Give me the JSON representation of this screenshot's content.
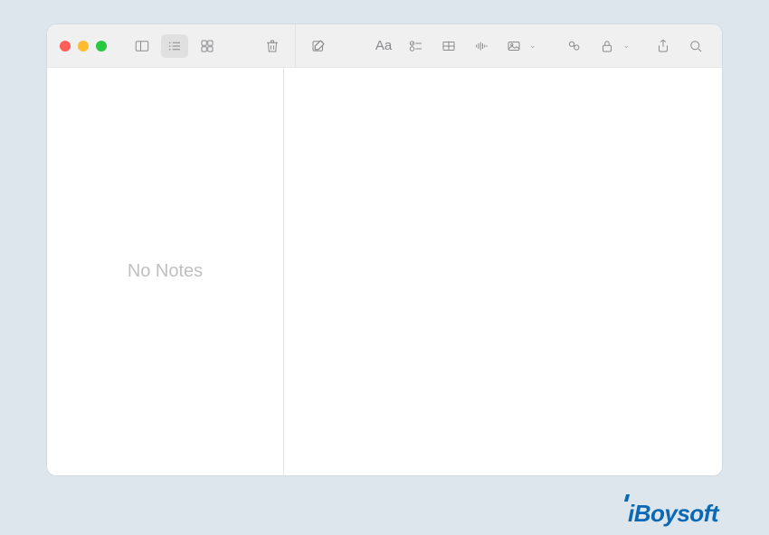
{
  "toolbar": {
    "icons": {
      "sidebar": "sidebar-toggle-icon",
      "list_view": "list-view-icon",
      "grid_view": "grid-view-icon",
      "trash": "trash-icon",
      "compose": "compose-icon",
      "format": "Aa",
      "checklist": "checklist-icon",
      "table": "table-icon",
      "waveform": "waveform-icon",
      "media": "media-icon",
      "link": "link-icon",
      "lock": "lock-icon",
      "share": "share-icon",
      "search": "search-icon"
    },
    "traffic_lights": {
      "close": "#ff5f57",
      "minimize": "#febc2e",
      "zoom": "#28c840"
    }
  },
  "notes_list": {
    "empty_label": "No Notes"
  },
  "watermark": {
    "text": "iBoysoft"
  }
}
